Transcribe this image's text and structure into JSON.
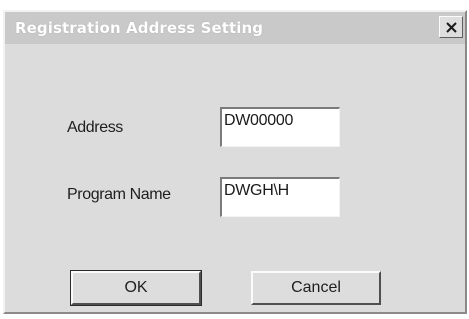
{
  "window": {
    "title": "Registration Address Setting",
    "close_icon": "close-icon"
  },
  "form": {
    "address_label": "Address",
    "address_value": "DW00000",
    "program_name_label": "Program Name",
    "program_name_value": "DWGH\\H"
  },
  "buttons": {
    "ok_label": "OK",
    "cancel_label": "Cancel"
  }
}
